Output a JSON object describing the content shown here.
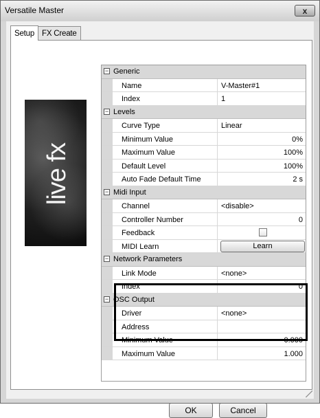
{
  "window": {
    "title": "Versatile Master",
    "close_label": "x"
  },
  "tabs": [
    {
      "label": "Setup",
      "active": true
    },
    {
      "label": "FX Create",
      "active": false
    }
  ],
  "logo": {
    "text": "live fx"
  },
  "grid": {
    "categories": [
      {
        "label": "Generic",
        "toggle": "−",
        "properties": [
          {
            "name": "Name",
            "value": "V-Master#1"
          },
          {
            "name": "Index",
            "value": "1"
          }
        ]
      },
      {
        "label": "Levels",
        "toggle": "−",
        "properties": [
          {
            "name": "Curve Type",
            "value": "Linear"
          },
          {
            "name": "Minimum Value",
            "value": "0%"
          },
          {
            "name": "Maximum Value",
            "value": "100%"
          },
          {
            "name": "Default Level",
            "value": "100%"
          },
          {
            "name": "Auto Fade Default Time",
            "value": "2 s"
          }
        ]
      },
      {
        "label": "Midi Input",
        "toggle": "−",
        "properties": [
          {
            "name": "Channel",
            "value": "<disable>"
          },
          {
            "name": "Controller Number",
            "value": "0"
          },
          {
            "name": "Feedback",
            "value": ""
          },
          {
            "name": "MIDI Learn",
            "value": "Learn"
          }
        ]
      },
      {
        "label": "Network Parameters",
        "toggle": "−",
        "properties": [
          {
            "name": "Link Mode",
            "value": "<none>"
          },
          {
            "name": "Index",
            "value": "0"
          }
        ]
      },
      {
        "label": "OSC Output",
        "toggle": "−",
        "properties": [
          {
            "name": "Driver",
            "value": "<none>"
          },
          {
            "name": "Address",
            "value": ""
          },
          {
            "name": "Minimum Value",
            "value": "0.000"
          },
          {
            "name": "Maximum Value",
            "value": "1.000"
          }
        ]
      }
    ]
  },
  "footer": {
    "ok_label": "OK",
    "cancel_label": "Cancel"
  }
}
